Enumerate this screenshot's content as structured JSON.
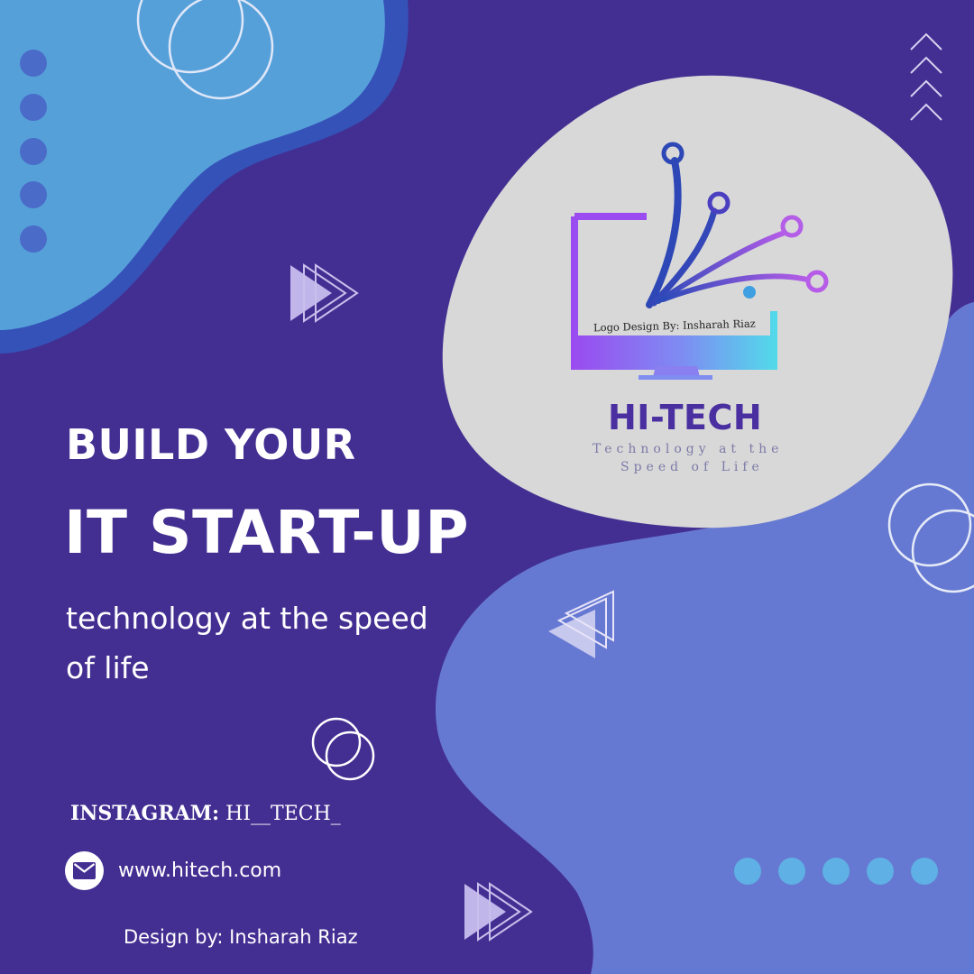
{
  "headline": {
    "line1": "BUILD YOUR",
    "line2": "IT START-UP",
    "tagline": "technology at the speed of life"
  },
  "contact": {
    "instagram_label": "INSTAGRAM:",
    "instagram_handle": "HI__TECH_",
    "website": "www.hitech.com",
    "email_icon": "mail-icon"
  },
  "credit": "Design by: Insharah Riaz",
  "logo": {
    "credit": "Logo Design By: Insharah Riaz",
    "brand": "HI-TECH",
    "slogan_line1": "Technology at the",
    "slogan_line2": "Speed of Life"
  },
  "colors": {
    "background": "#432f92",
    "blob_light_blue": "#56a0da",
    "blob_periwinkle": "#6679d2",
    "logo_circle": "#d8d8d8",
    "brand_text": "#4a2fa0",
    "dots_left": "#4a6bc8",
    "dots_right": "#5fb0e4"
  }
}
